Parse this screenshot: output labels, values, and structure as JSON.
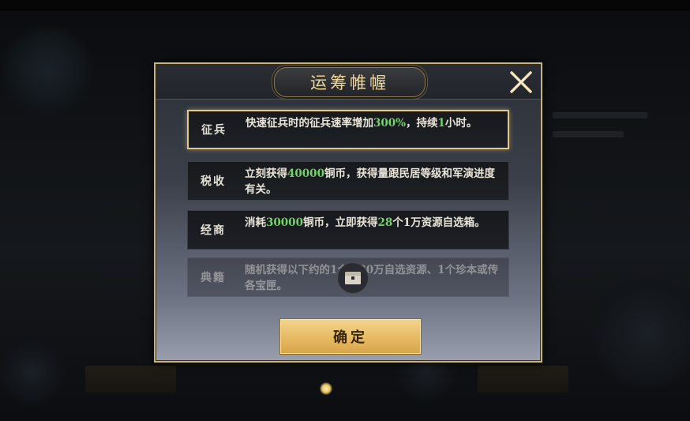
{
  "dialog": {
    "title": "运筹帷幄",
    "close_icon": "close-x-icon",
    "rows": [
      {
        "label": "征兵",
        "segments": [
          {
            "text": "快速征兵时的征兵速率增加",
            "hl": false
          },
          {
            "text": "300%",
            "hl": true
          },
          {
            "text": "，持续",
            "hl": false
          },
          {
            "text": "1",
            "hl": true
          },
          {
            "text": "小时。",
            "hl": false
          }
        ],
        "selected": true
      },
      {
        "label": "税收",
        "segments": [
          {
            "text": "立刻获得",
            "hl": false
          },
          {
            "text": "40000",
            "hl": true
          },
          {
            "text": "铜币，获得量跟民居等级和军演进度有关。",
            "hl": false
          }
        ],
        "selected": false
      },
      {
        "label": "经商",
        "segments": [
          {
            "text": "消耗",
            "hl": false
          },
          {
            "text": "30000",
            "hl": true
          },
          {
            "text": "铜币，立即获得",
            "hl": false
          },
          {
            "text": "28",
            "hl": true
          },
          {
            "text": "个1万资源自选箱。",
            "hl": false
          }
        ],
        "selected": false
      },
      {
        "label": "典籍",
        "segments": [
          {
            "text": "随机获得以下约",
            "hl": false
          },
          {
            "text": "的1个：30万自选资源、1个珍本或传",
            "hl": false
          },
          {
            "text": "各宝匣。",
            "hl": false
          }
        ],
        "selected": false,
        "locked": true
      }
    ],
    "confirm_label": "确定"
  },
  "colors": {
    "accent_gold": "#e4c884",
    "highlight_green": "#73d46c"
  }
}
